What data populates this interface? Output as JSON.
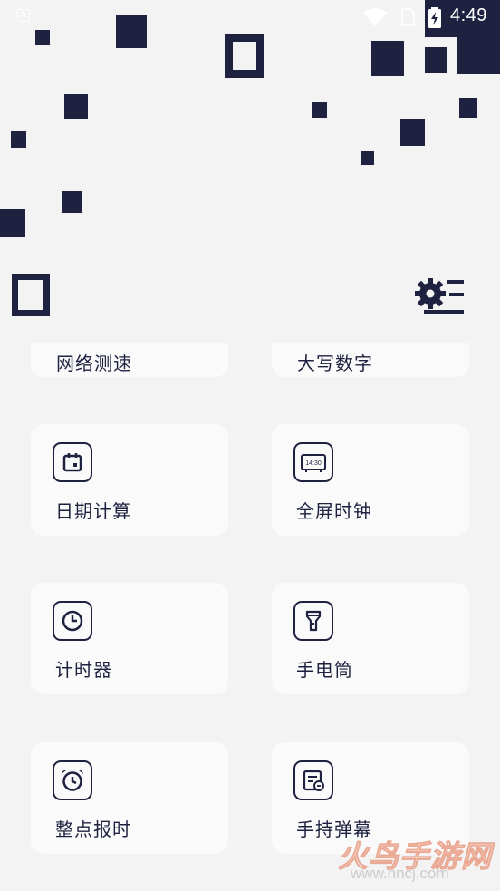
{
  "status_bar": {
    "time": "4:49",
    "notification_icon": "A",
    "icons": [
      "wifi-icon",
      "sim-icon",
      "battery-charging-icon"
    ]
  },
  "header": {
    "settings_icon": "gear-menu-icon"
  },
  "tools": [
    {
      "id": "network-speed",
      "label": "网络测速",
      "icon": "speed-icon"
    },
    {
      "id": "uppercase-numbers",
      "label": "大写数字",
      "icon": "number-icon"
    },
    {
      "id": "date-calc",
      "label": "日期计算",
      "icon": "calendar-icon"
    },
    {
      "id": "fullscreen-clock",
      "label": "全屏时钟",
      "icon": "digital-clock-icon",
      "icon_text": "14:30"
    },
    {
      "id": "timer",
      "label": "计时器",
      "icon": "clock-icon"
    },
    {
      "id": "flashlight",
      "label": "手电筒",
      "icon": "flashlight-icon"
    },
    {
      "id": "hourly-chime",
      "label": "整点报时",
      "icon": "alarm-clock-icon"
    },
    {
      "id": "handheld-danmaku",
      "label": "手持弹幕",
      "icon": "danmaku-icon"
    }
  ],
  "watermark": {
    "text": "火鸟手游网",
    "url": "www.hncj.com"
  },
  "colors": {
    "primary": "#1e2240",
    "background": "#f3f3f3",
    "card": "#fafafa"
  }
}
